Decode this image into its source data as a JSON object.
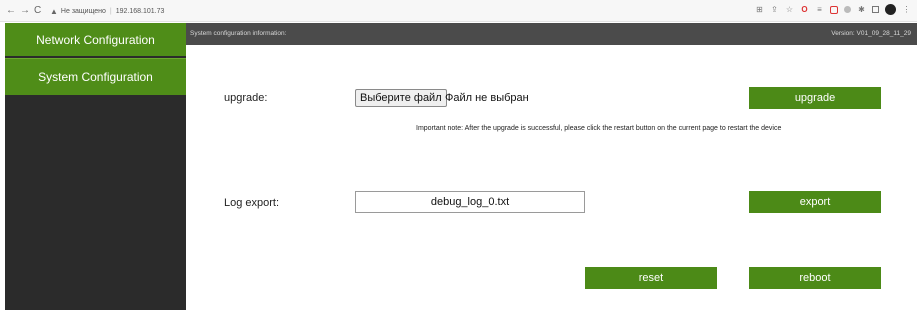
{
  "browser": {
    "back_icon": "←",
    "forward_icon": "→",
    "reload_icon": "C",
    "security_text": "Не защищено",
    "url": "192.168.101.73"
  },
  "sidebar": {
    "items": [
      {
        "label": "Network Configuration"
      },
      {
        "label": "System Configuration"
      }
    ]
  },
  "header": {
    "info": "System configuration information:",
    "version": "Version: V01_09_28_11_29"
  },
  "upgrade": {
    "label": "upgrade:",
    "choose_file": "Выберите файл",
    "no_file": "Файл не выбран",
    "button": "upgrade",
    "note": "Important note: After the upgrade is successful, please click the restart button on the current page to restart the device"
  },
  "log": {
    "label": "Log export:",
    "filename": "debug_log_0.txt",
    "button": "export"
  },
  "actions": {
    "reset": "reset",
    "reboot": "reboot"
  },
  "colors": {
    "accent_green": "#4c8a17",
    "sidebar_bg": "#2b2b2b",
    "header_bg": "#4b4b4b"
  }
}
